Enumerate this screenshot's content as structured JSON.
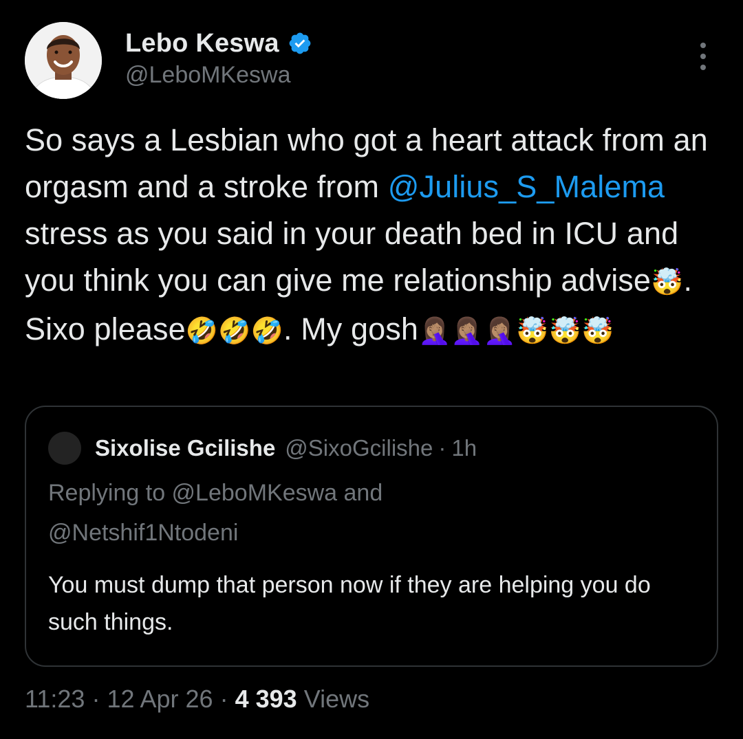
{
  "author": {
    "display_name": "Lebo Keswa",
    "handle": "@LeboMKeswa",
    "verified": true,
    "verified_color": "#1d9bf0"
  },
  "tweet": {
    "text_parts": [
      "So says a Lesbian who got a heart attack from an orgasm and a stroke from ",
      "@Julius_S_Malema",
      " stress as you said in your death bed in ICU and you think you can give me relationship advise",
      "🤯",
      ". Sixo please",
      "🤣🤣🤣",
      ". My gosh",
      "🤦🏽‍♀️🤦🏽‍♀️🤦🏽‍♀️🤯🤯🤯"
    ],
    "mention_color": "#1d9bf0"
  },
  "quoted_tweet": {
    "display_name": "Sixolise Gcilishe",
    "handle": "@SixoGcilishe",
    "separator": "·",
    "time": "1h",
    "replying_line1": "Replying to @LeboMKeswa and",
    "replying_line2": "@Netshif1Ntodeni",
    "text": "You must dump that person now if they are helping you do such things."
  },
  "footer": {
    "time": "11:23",
    "date": "12 Apr 26",
    "views_count": "4 393",
    "views_label": "Views",
    "separator": "·"
  },
  "icons": {
    "verified": "verified-badge-icon",
    "more": "more-vertical-icon"
  }
}
